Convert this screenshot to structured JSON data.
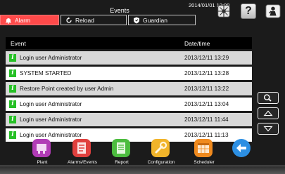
{
  "header": {
    "title": "Events",
    "datetime": "2014/01/01  12:00"
  },
  "tabs": [
    {
      "label": "Alarm",
      "icon": "bell-icon",
      "color": "#ff4a4a"
    },
    {
      "label": "Reload",
      "icon": "reload-icon"
    },
    {
      "label": "Guardian",
      "icon": "shield-icon"
    }
  ],
  "top_icons": [
    "network-status-icon",
    "help-icon",
    "user-icon"
  ],
  "table": {
    "columns": [
      "Event",
      "Date/time"
    ],
    "rows": [
      {
        "event": "Login user Administrator",
        "datetime": "2013/12/11 13:29"
      },
      {
        "event": "SYSTEM STARTED",
        "datetime": "2013/12/11 13:28"
      },
      {
        "event": "Restore Point created by user Admin",
        "datetime": "2013/12/11 13:22"
      },
      {
        "event": "Login user Administrator",
        "datetime": "2013/12/11 13:04"
      },
      {
        "event": "Login user Administrator",
        "datetime": "2013/12/11 11:44"
      },
      {
        "event": "Login user Administrator",
        "datetime": "2013/12/11 11:13"
      }
    ],
    "row_icon_text": "i",
    "row_icon_color": "#26c026"
  },
  "side_buttons": [
    "search-icon",
    "scroll-up-icon",
    "scroll-down-icon"
  ],
  "nav": [
    {
      "label": "Plant",
      "color": "#b13bb6"
    },
    {
      "label": "Alarms/Events",
      "color": "#e0403e"
    },
    {
      "label": "Report",
      "color": "#4cbc3f"
    },
    {
      "label": "Configuration",
      "color": "#f1b42a"
    },
    {
      "label": "Scheduler",
      "color": "#f08a1e"
    },
    {
      "label": "",
      "color": "#2c8fe3"
    }
  ]
}
